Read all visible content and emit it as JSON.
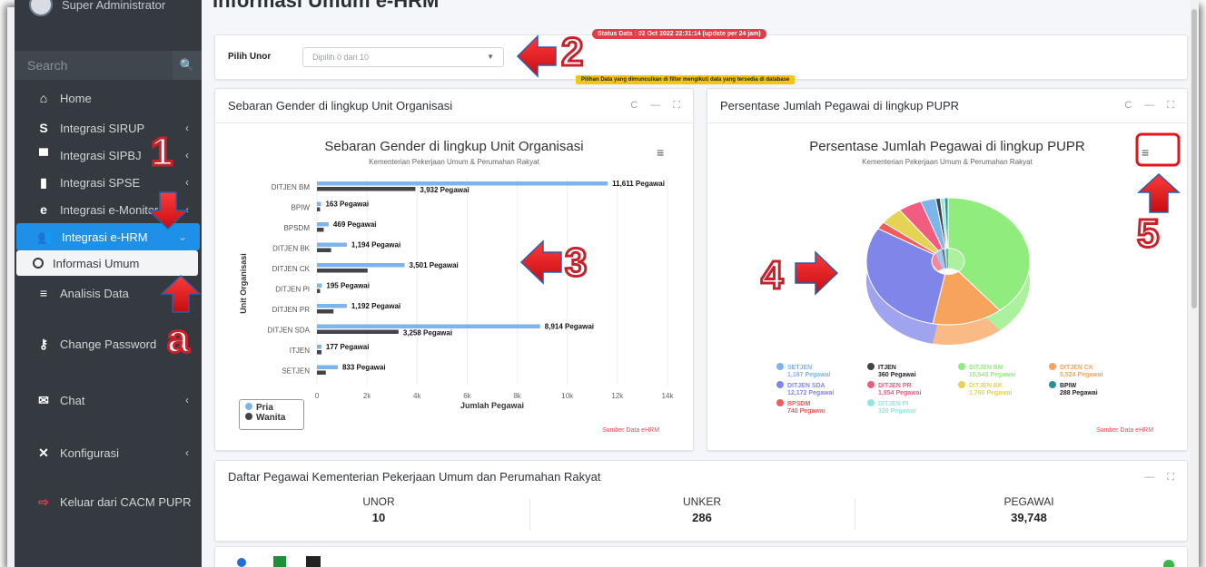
{
  "sidebar": {
    "user_name": "Super Administrator",
    "search_placeholder": "Search",
    "items": [
      {
        "label": "Home",
        "icon": "home-icon",
        "glyph": "⌂",
        "has_chevron": false
      },
      {
        "label": "Integrasi SIRUP",
        "icon": "dollar-icon",
        "glyph": "S",
        "has_chevron": true
      },
      {
        "label": "Integrasi SIPBJ",
        "icon": "cart-icon",
        "glyph": "▀",
        "has_chevron": true
      },
      {
        "label": "Integrasi SPSE",
        "icon": "building-icon",
        "glyph": "▮",
        "has_chevron": true
      },
      {
        "label": "Integrasi e-Monitor",
        "icon": "edge-icon",
        "glyph": "e",
        "has_chevron": true
      },
      {
        "label": "Integrasi e-HRM",
        "icon": "users-icon",
        "glyph": "👥",
        "has_chevron": true,
        "active": true
      },
      {
        "label": "Informasi Umum",
        "sub": true
      },
      {
        "label": "Analisis Data",
        "icon": "database-icon",
        "glyph": "≡",
        "has_chevron": false
      },
      {
        "label": "Change Password",
        "icon": "key-icon",
        "glyph": "⚷",
        "has_chevron": false
      },
      {
        "label": "Chat",
        "icon": "chat-icon",
        "glyph": "✉",
        "has_chevron": true
      },
      {
        "label": "Konfigurasi",
        "icon": "tools-icon",
        "glyph": "✕",
        "has_chevron": true
      },
      {
        "label": "Keluar dari CACM PUPR",
        "icon": "logout-icon",
        "glyph": "⇨",
        "has_chevron": false
      }
    ]
  },
  "page": {
    "title": "Informasi Umum e-HRM"
  },
  "filter": {
    "label": "Pilih Unor",
    "select_value": "Dipilih 0 dari 10",
    "status_badge": "Status Data : 02 Oct 2022 22:31:14 (update per 24 jam)",
    "note_badge": "Pilihan Data yang dimunculkan di filter mengikuti data yang tersedia di database"
  },
  "gender_card": {
    "header": "Sebaran Gender di lingkup Unit Organisasi",
    "source": "Sumber Data eHRM"
  },
  "persen_card": {
    "header": "Persentase Jumlah Pegawai di lingkup PUPR",
    "source": "Sumber Data eHRM"
  },
  "daftar": {
    "header": "Daftar Pegawai Kementerian Pekerjaan Umum dan Perumahan Rakyat",
    "stats": [
      {
        "key": "UNOR",
        "value": "10"
      },
      {
        "key": "UNKER",
        "value": "286"
      },
      {
        "key": "PEGAWAI",
        "value": "39,748"
      }
    ]
  },
  "annotations": [
    "1",
    "2",
    "3",
    "4",
    "5",
    "a"
  ],
  "colors": {
    "pria": "#7cb5ec",
    "wanita": "#434348",
    "active_nav": "#1e90e8",
    "annotation": "#e3141c"
  },
  "chart_data": [
    {
      "type": "bar",
      "orientation": "horizontal",
      "title": "Sebaran Gender di lingkup Unit Organisasi",
      "subtitle": "Kementerian Pekerjaan Umum & Perumahan Rakyat",
      "xlabel": "Jumlah Pegawai",
      "ylabel": "Unit Organisasi",
      "xlim": [
        0,
        14000
      ],
      "ticks": [
        "0",
        "2k",
        "4k",
        "6k",
        "8k",
        "10k",
        "12k",
        "14k"
      ],
      "categories": [
        "DITJEN BM",
        "BPIW",
        "BPSDM",
        "DITJEN BK",
        "DITJEN CK",
        "DITJEN PI",
        "DITJEN PR",
        "DITJEN SDA",
        "ITJEN",
        "SETJEN"
      ],
      "series": [
        {
          "name": "Pria",
          "color": "#7cb5ec",
          "values": [
            11611,
            163,
            469,
            1194,
            3501,
            195,
            1192,
            8914,
            177,
            833
          ]
        },
        {
          "name": "Wanita",
          "color": "#434348",
          "values": [
            3932,
            125,
            271,
            566,
            2023,
            125,
            662,
            3258,
            183,
            354
          ]
        }
      ],
      "data_labels": [
        "11,611 Pegawai",
        "3,932 Pegawai",
        "163 Pegawai",
        "469 Pegawai",
        "1,194 Pegawai",
        "3,501 Pegawai",
        "195 Pegawai",
        "1,192 Pegawai",
        "8,914 Pegawai",
        "3,258 Pegawai",
        "177 Pegawai",
        "833 Pegawai"
      ],
      "legend": "bottom-left"
    },
    {
      "type": "pie",
      "title": "Persentase Jumlah Pegawai di lingkup PUPR",
      "subtitle": "Kementerian Pekerjaan Umum & Perumahan Rakyat",
      "slices": [
        {
          "name": "SETJEN",
          "value": 1187,
          "label": "1,187 Pegawai",
          "color": "#7cb5ec"
        },
        {
          "name": "ITJEN",
          "value": 360,
          "label": "360 Pegawai",
          "color": "#434348"
        },
        {
          "name": "DITJEN BM",
          "value": 15543,
          "label": "15,543 Pegawai",
          "color": "#90ed7d"
        },
        {
          "name": "DITJEN CK",
          "value": 5524,
          "label": "5,524 Pegawai",
          "color": "#f7a35c"
        },
        {
          "name": "DITJEN SDA",
          "value": 12172,
          "label": "12,172 Pegawai",
          "color": "#8085e9"
        },
        {
          "name": "DITJEN PR",
          "value": 1854,
          "label": "1,854 Pegawai",
          "color": "#f15c80"
        },
        {
          "name": "DITJEN BK",
          "value": 1760,
          "label": "1,760 Pegawai",
          "color": "#e4d354"
        },
        {
          "name": "BPIW",
          "value": 288,
          "label": "288 Pegawai",
          "color": "#2b908f"
        },
        {
          "name": "BPSDM",
          "value": 740,
          "label": "740 Pegawai",
          "color": "#f45b5b"
        },
        {
          "name": "DITJEN PI",
          "value": 320,
          "label": "320 Pegawai",
          "color": "#91e8e1"
        }
      ],
      "legend": "bottom"
    }
  ]
}
